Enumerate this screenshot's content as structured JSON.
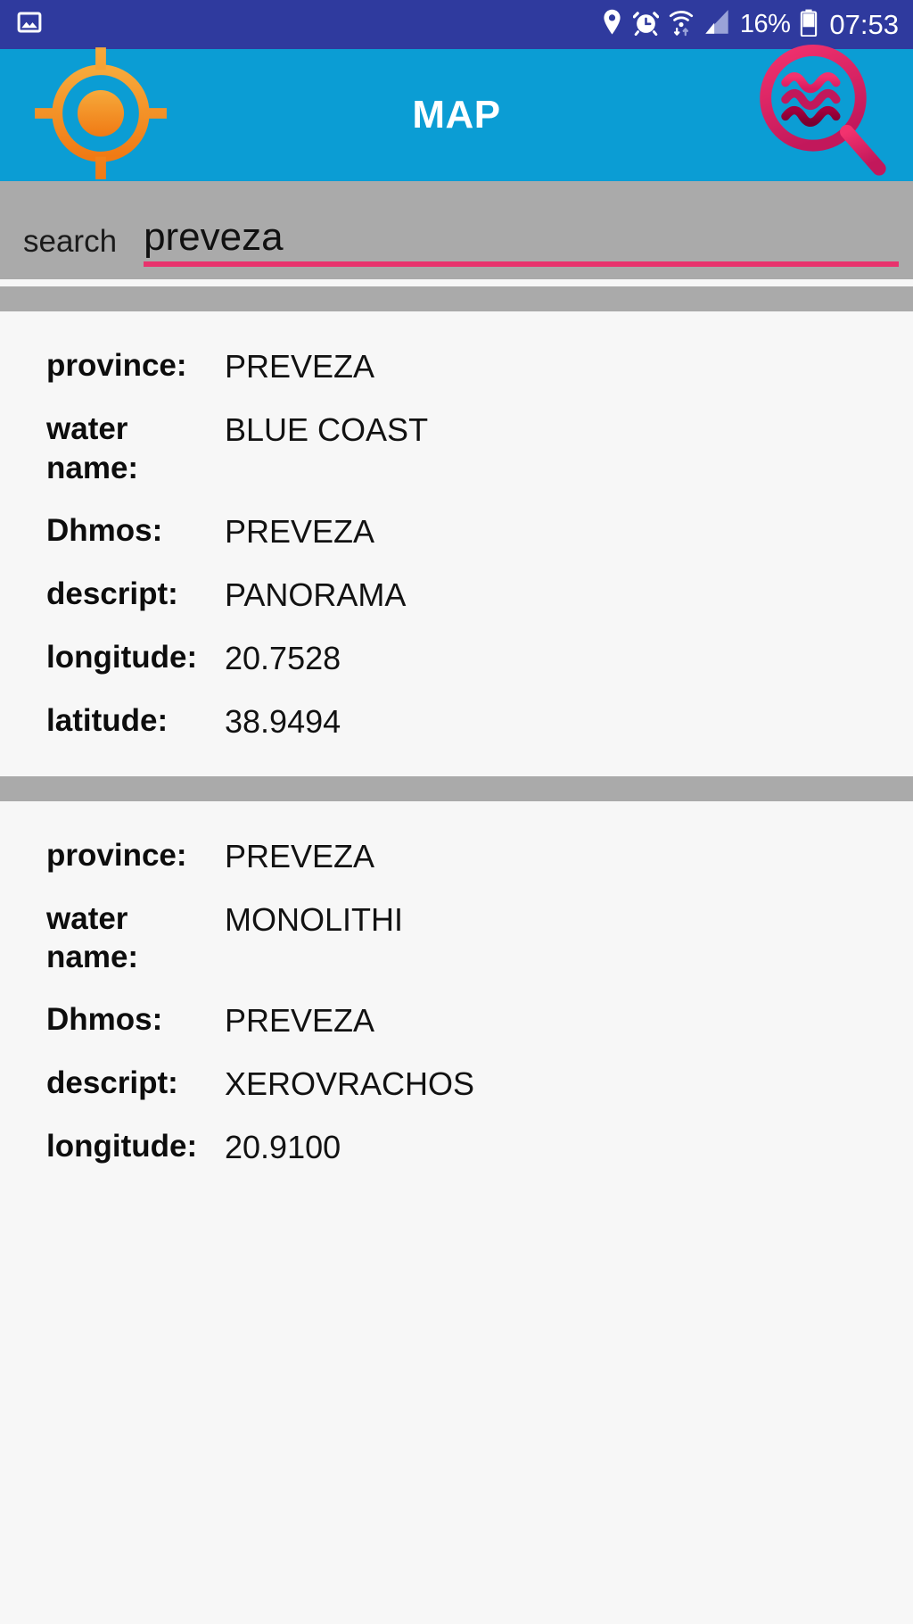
{
  "status_bar": {
    "background": "#2f3a9e",
    "left_icons": [
      "image-icon"
    ],
    "right_icons": [
      "location-pin-icon",
      "alarm-clock-icon",
      "wifi-icon",
      "cellular-signal-icon"
    ],
    "battery_percent": "16%",
    "battery_icon": "battery-icon",
    "time": "07:53"
  },
  "app_bar": {
    "title": "MAP",
    "background": "#0b9dd4",
    "left_icon": "gps-target-icon",
    "left_icon_color": "#f2922c",
    "right_icon": "water-search-icon",
    "right_icon_color": "#e8336d"
  },
  "search": {
    "label": "search",
    "value": "preveza",
    "placeholder": "search",
    "underline_color": "#e8336d",
    "background": "#aaaaaa"
  },
  "results": [
    {
      "rows": [
        {
          "label": "province:",
          "value": "PREVEZA"
        },
        {
          "label": "water name:",
          "value": "BLUE COAST"
        },
        {
          "label": "Dhmos:",
          "value": "PREVEZA"
        },
        {
          "label": "descript:",
          "value": "PANORAMA"
        },
        {
          "label": "longitude:",
          "value": "20.7528"
        },
        {
          "label": "latitude:",
          "value": "38.9494"
        }
      ]
    },
    {
      "rows": [
        {
          "label": "province:",
          "value": "PREVEZA"
        },
        {
          "label": "water name:",
          "value": "MONOLITHI"
        },
        {
          "label": "Dhmos:",
          "value": "PREVEZA"
        },
        {
          "label": "descript:",
          "value": "XEROVRACHOS"
        },
        {
          "label": "longitude:",
          "value": "20.9100"
        }
      ]
    }
  ]
}
